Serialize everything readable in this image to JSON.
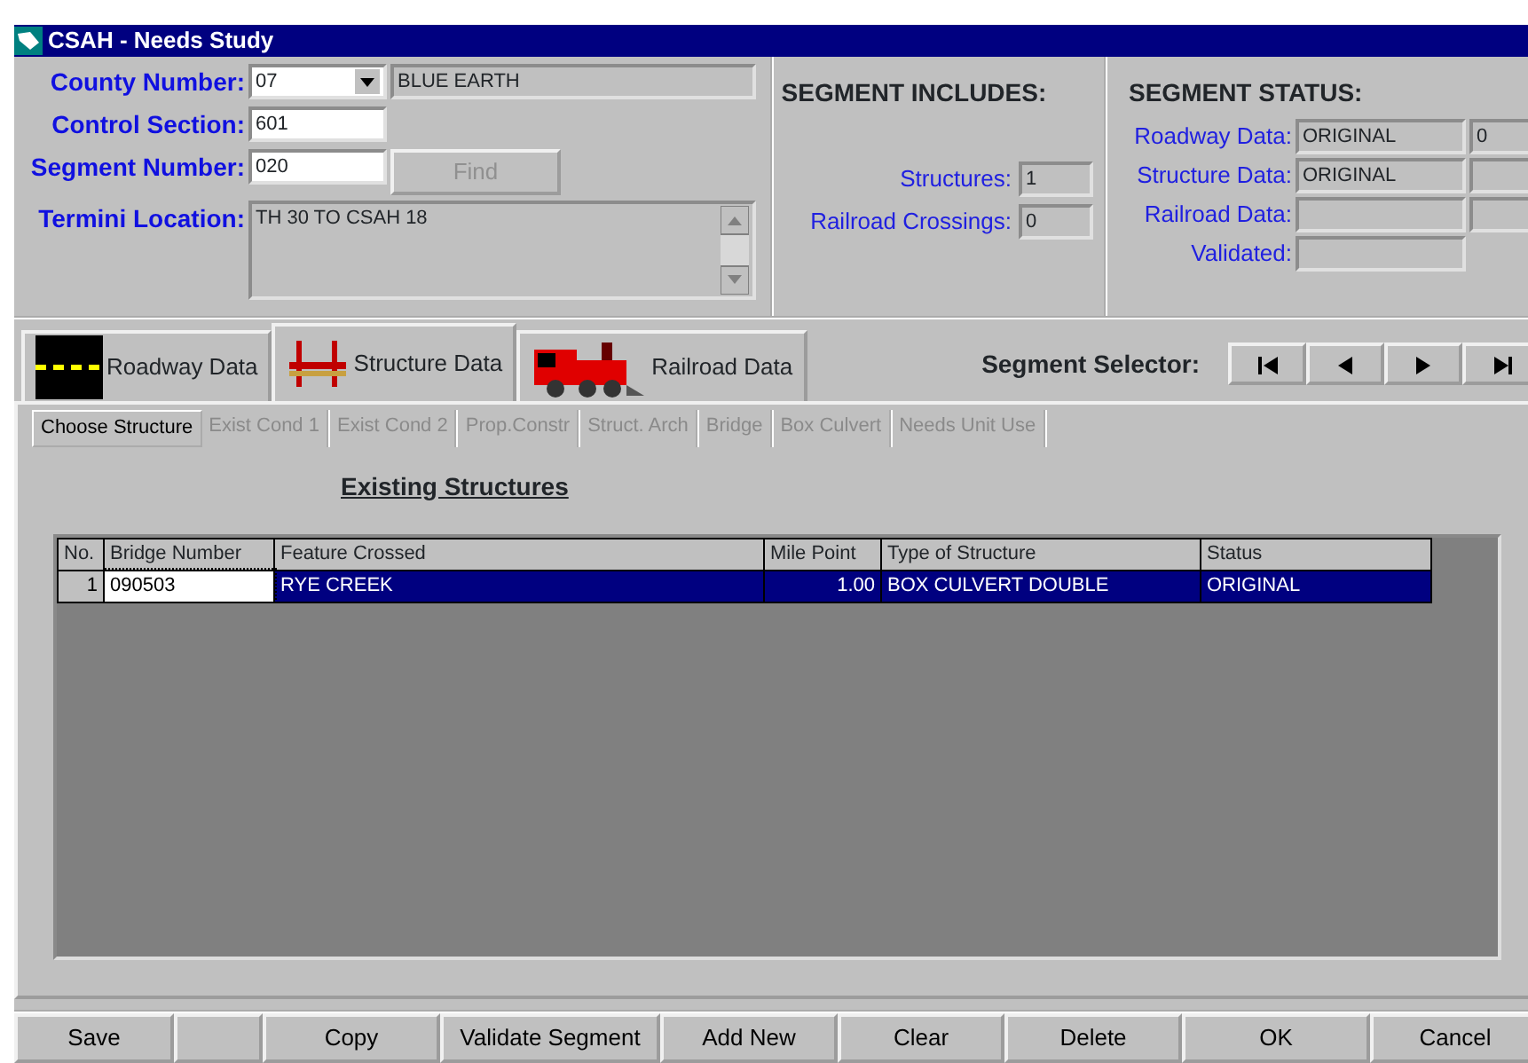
{
  "window": {
    "title": "CSAH - Needs Study"
  },
  "segment_form": {
    "county_number": {
      "label": "County Number:",
      "value": "07",
      "name": "BLUE EARTH"
    },
    "control_section": {
      "label": "Control Section:",
      "value": "601"
    },
    "segment_number": {
      "label": "Segment Number:",
      "value": "020"
    },
    "find_button": {
      "label": "Find",
      "disabled": true
    },
    "termini_location": {
      "label": "Termini Location:",
      "value": "TH 30 TO CSAH 18"
    }
  },
  "segment_includes": {
    "title": "SEGMENT INCLUDES:",
    "rows": [
      {
        "label": "Structures:",
        "value": "1"
      },
      {
        "label": "Railroad Crossings:",
        "value": "0"
      }
    ]
  },
  "segment_status": {
    "title": "SEGMENT STATUS:",
    "rows": [
      {
        "label": "Roadway Data:",
        "value": "ORIGINAL",
        "extra": "0"
      },
      {
        "label": "Structure Data:",
        "value": "ORIGINAL"
      },
      {
        "label": "Railroad Data:"
      },
      {
        "label": "Validated:",
        "kind": "single"
      }
    ]
  },
  "tabs": [
    {
      "label": "Roadway Data",
      "kind": "road",
      "selected": false
    },
    {
      "label": "Structure Data",
      "kind": "bridge",
      "selected": true
    },
    {
      "label": "Railroad Data",
      "kind": "train",
      "selected": false
    }
  ],
  "segment_selector": {
    "label": "Segment Selector:",
    "buttons": [
      {
        "kind": "first"
      },
      {
        "kind": "prev"
      },
      {
        "kind": "next"
      },
      {
        "kind": "last"
      }
    ]
  },
  "sub_tabs": [
    {
      "label": "Choose Structure",
      "selected": true,
      "disabled": false
    },
    {
      "label": "Exist Cond 1",
      "selected": false,
      "disabled": true
    },
    {
      "label": "Exist Cond 2",
      "selected": false,
      "disabled": true
    },
    {
      "label": "Prop.Constr",
      "selected": false,
      "disabled": true
    },
    {
      "label": "Struct. Arch",
      "selected": false,
      "disabled": true
    },
    {
      "label": "Bridge",
      "selected": false,
      "disabled": true
    },
    {
      "label": "Box Culvert",
      "selected": false,
      "disabled": true
    },
    {
      "label": "Needs Unit Use",
      "selected": false,
      "disabled": true
    }
  ],
  "structures": {
    "title": "Existing Structures",
    "columns": [
      "No.",
      "Bridge Number",
      "Feature Crossed",
      "Mile Point",
      "Type of Structure",
      "Status"
    ],
    "rows": [
      {
        "cells": [
          "1",
          "090503",
          "RYE CREEK",
          "1.00",
          "BOX CULVERT DOUBLE",
          "ORIGINAL"
        ],
        "selected": true
      }
    ]
  },
  "buttons": [
    {
      "label": "Save"
    },
    {
      "kind": "blank"
    },
    {
      "label": "Copy"
    },
    {
      "label": "Validate Segment"
    },
    {
      "label": "Add New"
    },
    {
      "label": "Clear"
    },
    {
      "label": "Delete"
    },
    {
      "label": "OK"
    },
    {
      "label": "Cancel"
    }
  ]
}
